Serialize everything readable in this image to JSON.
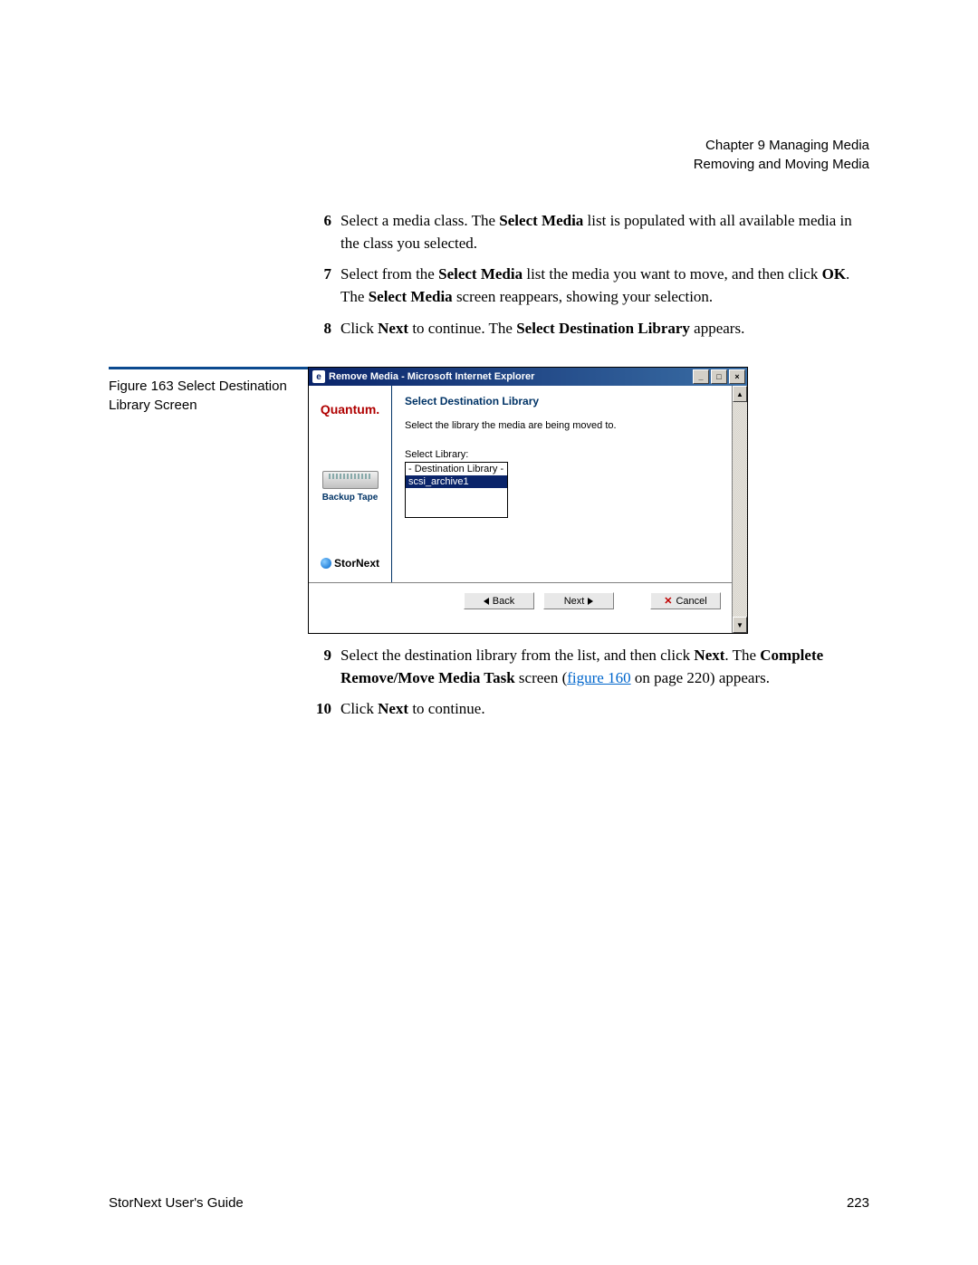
{
  "header": {
    "chapter": "Chapter 9  Managing Media",
    "section": "Removing and Moving Media"
  },
  "steps_top": [
    {
      "num": "6",
      "parts": [
        {
          "t": "Select a media class. The "
        },
        {
          "t": "Select Media",
          "b": true
        },
        {
          "t": " list is populated with all available media in the class you selected."
        }
      ]
    },
    {
      "num": "7",
      "parts": [
        {
          "t": "Select from the "
        },
        {
          "t": "Select Media",
          "b": true
        },
        {
          "t": " list the media you want to move, and then click "
        },
        {
          "t": "OK",
          "b": true
        },
        {
          "t": ". The "
        },
        {
          "t": "Select Media",
          "b": true
        },
        {
          "t": " screen reappears, showing your selection."
        }
      ]
    },
    {
      "num": "8",
      "parts": [
        {
          "t": "Click "
        },
        {
          "t": "Next",
          "b": true
        },
        {
          "t": " to continue. The "
        },
        {
          "t": "Select Destination Library",
          "b": true
        },
        {
          "t": " appears."
        }
      ]
    }
  ],
  "figure_caption": "Figure 163  Select Destination Library Screen",
  "window": {
    "title": "Remove Media - Microsoft Internet Explorer",
    "quantum": "Quantum.",
    "tape_label": "Backup Tape",
    "stornext": "StorNext",
    "panel_title": "Select Destination Library",
    "instruction": "Select the library the media are being moved to.",
    "select_label": "Select Library:",
    "options": [
      "- Destination Library -",
      "scsi_archive1"
    ],
    "selected_index": 1,
    "buttons": {
      "back": "Back",
      "next": "Next",
      "cancel": "Cancel"
    }
  },
  "steps_bottom": [
    {
      "num": "9",
      "parts": [
        {
          "t": "Select the destination library from the list, and then click "
        },
        {
          "t": "Next",
          "b": true
        },
        {
          "t": ". The "
        },
        {
          "t": "Complete Remove/Move Media Task",
          "b": true
        },
        {
          "t": " screen ("
        },
        {
          "t": "figure 160",
          "link": true
        },
        {
          "t": " on page 220) appears."
        }
      ]
    },
    {
      "num": "10",
      "parts": [
        {
          "t": "Click "
        },
        {
          "t": "Next",
          "b": true
        },
        {
          "t": " to continue."
        }
      ]
    }
  ],
  "footer": {
    "guide": "StorNext User's Guide",
    "page": "223"
  }
}
